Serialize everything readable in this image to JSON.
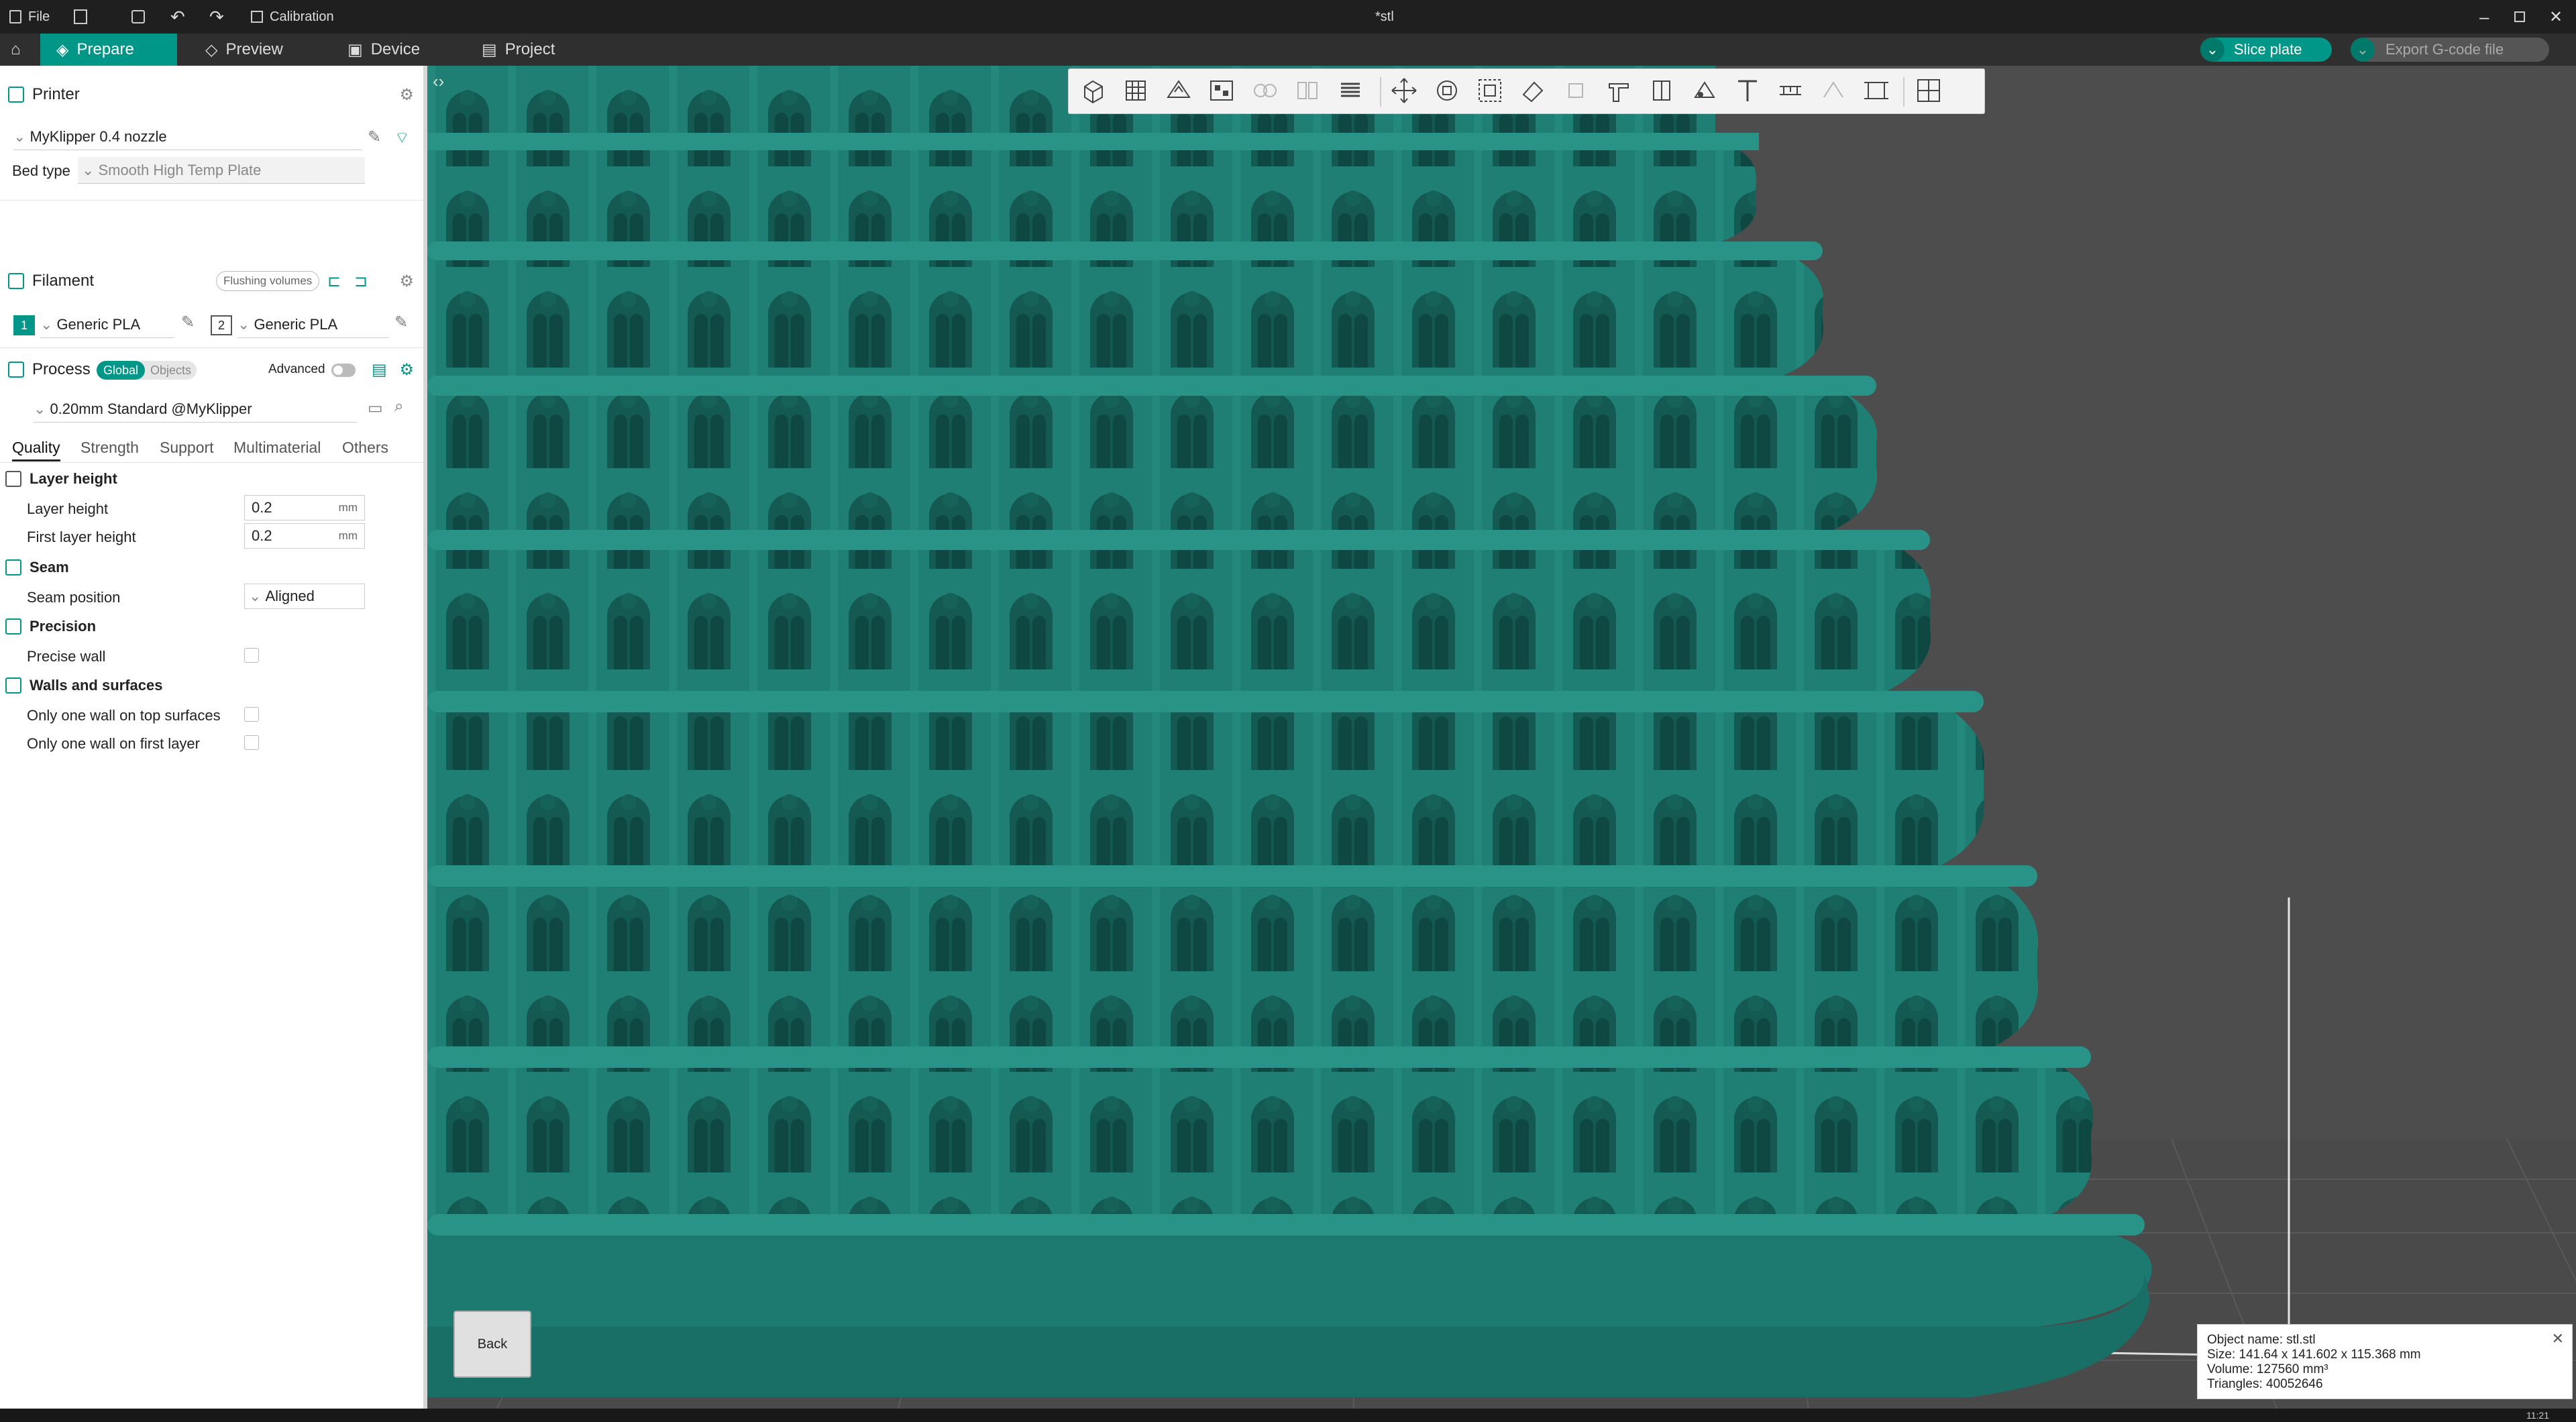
{
  "titlebar": {
    "menu_file": "File",
    "calibration": "Calibration",
    "window_title": "*stl"
  },
  "tabs": [
    {
      "label": "Prepare"
    },
    {
      "label": "Preview"
    },
    {
      "label": "Device"
    },
    {
      "label": "Project"
    }
  ],
  "actions": {
    "slice_plate": "Slice plate",
    "export_gcode": "Export G-code file"
  },
  "printer": {
    "section_title": "Printer",
    "printer_name": "MyKlipper 0.4 nozzle",
    "bed_type_label": "Bed type",
    "bed_type_value": "Smooth High Temp Plate"
  },
  "filament": {
    "section_title": "Filament",
    "flushing_volumes": "Flushing volumes",
    "slots": [
      {
        "index": "1",
        "name": "Generic PLA"
      },
      {
        "index": "2",
        "name": "Generic PLA"
      }
    ]
  },
  "process": {
    "section_title": "Process",
    "scope_global": "Global",
    "scope_objects": "Objects",
    "advanced_label": "Advanced",
    "preset": "0.20mm Standard @MyKlipper",
    "tabs": [
      "Quality",
      "Strength",
      "Support",
      "Multimaterial",
      "Others"
    ]
  },
  "quality": {
    "group_layer_height": "Layer height",
    "layer_height_label": "Layer height",
    "layer_height_value": "0.2",
    "first_layer_height_label": "First layer height",
    "first_layer_height_value": "0.2",
    "unit": "mm",
    "group_seam": "Seam",
    "seam_position_label": "Seam position",
    "seam_position_value": "Aligned",
    "group_precision": "Precision",
    "precise_wall_label": "Precise wall",
    "group_walls": "Walls and surfaces",
    "one_wall_top_label": "Only one wall on top surfaces",
    "one_wall_first_label": "Only one wall on first layer"
  },
  "viewport": {
    "view_cube_label": "Back",
    "model_color": "#1f7f74",
    "object_info": {
      "name": "Object name: stl.stl",
      "size": "Size: 141.64 x 141.602 x 115.368 mm",
      "volume": "Volume: 127560 mm³",
      "triangles": "Triangles: 40052646"
    }
  },
  "clock": "11:21"
}
